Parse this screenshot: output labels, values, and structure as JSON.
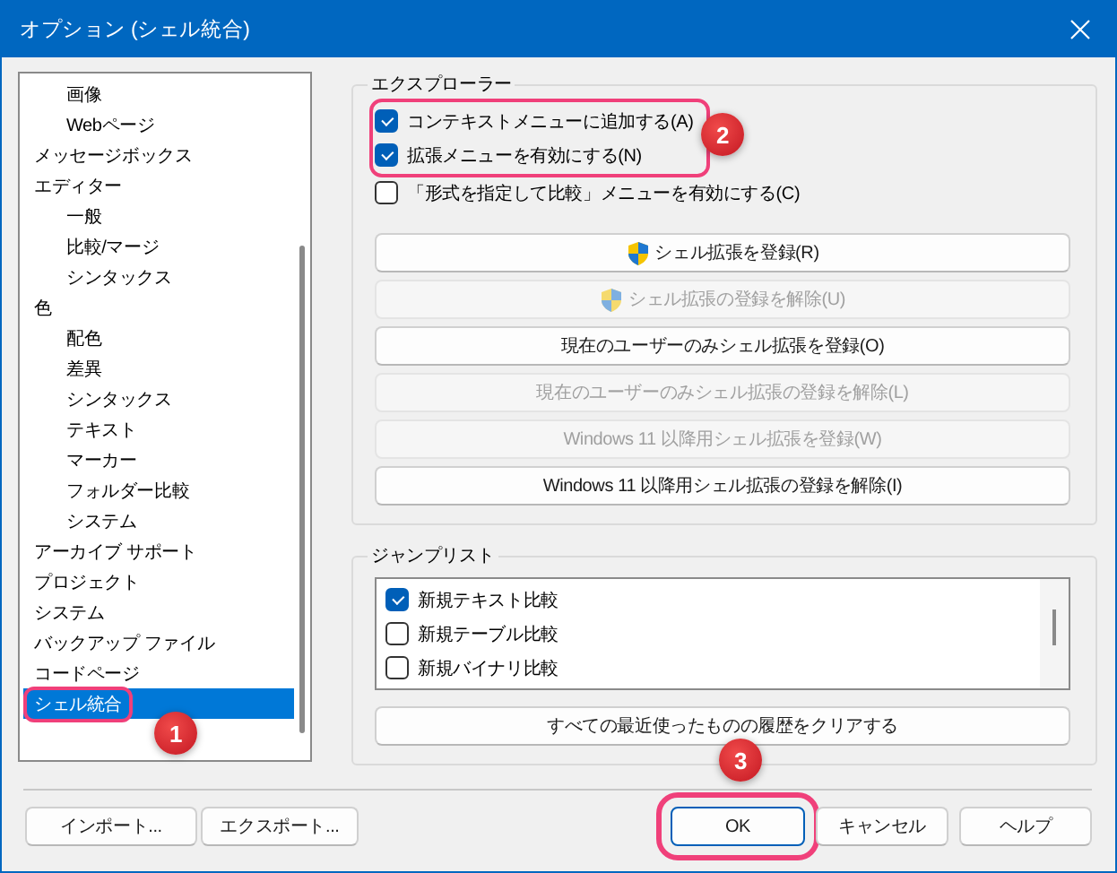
{
  "window": {
    "title": "オプション (シェル統合)"
  },
  "tree": {
    "items": [
      {
        "children": [
          {
            "label": "画像",
            "selected": false,
            "highlighted": false
          },
          {
            "label": "Webページ",
            "selected": false,
            "highlighted": false
          }
        ]
      },
      {
        "label": "メッセージボックス",
        "selected": false,
        "highlighted": false
      },
      {
        "label": "エディター",
        "selected": false,
        "highlighted": false,
        "children": [
          {
            "label": "一般",
            "selected": false,
            "highlighted": false
          },
          {
            "label": "比較/マージ",
            "selected": false,
            "highlighted": false
          },
          {
            "label": "シンタックス",
            "selected": false,
            "highlighted": false
          }
        ]
      },
      {
        "label": "色",
        "selected": false,
        "highlighted": false,
        "children": [
          {
            "label": "配色",
            "selected": false,
            "highlighted": false
          },
          {
            "label": "差異",
            "selected": false,
            "highlighted": false
          },
          {
            "label": "シンタックス",
            "selected": false,
            "highlighted": false
          },
          {
            "label": "テキスト",
            "selected": false,
            "highlighted": false
          },
          {
            "label": "マーカー",
            "selected": false,
            "highlighted": false
          },
          {
            "label": "フォルダー比較",
            "selected": false,
            "highlighted": false
          },
          {
            "label": "システム",
            "selected": false,
            "highlighted": false
          }
        ]
      },
      {
        "label": "アーカイブ サポート",
        "selected": false,
        "highlighted": false
      },
      {
        "label": "プロジェクト",
        "selected": false,
        "highlighted": false
      },
      {
        "label": "システム",
        "selected": false,
        "highlighted": false
      },
      {
        "label": "バックアップ ファイル",
        "selected": false,
        "highlighted": false
      },
      {
        "label": "コードページ",
        "selected": false,
        "highlighted": false
      },
      {
        "label": "シェル統合",
        "selected": true,
        "highlighted": true
      }
    ]
  },
  "explorer": {
    "title": "エクスプローラー",
    "options": [
      {
        "label": "コンテキストメニューに追加する(A)",
        "checked": true,
        "highlighted": true
      },
      {
        "label": "拡張メニューを有効にする(N)",
        "checked": true,
        "highlighted": true
      },
      {
        "label": "「形式を指定して比較」メニューを有効にする(C)",
        "checked": false,
        "highlighted": false
      }
    ],
    "buttons": [
      {
        "label": "シェル拡張を登録(R)",
        "shield": true,
        "disabled": false
      },
      {
        "label": "シェル拡張の登録を解除(U)",
        "shield": true,
        "disabled": true
      },
      {
        "label": "現在のユーザーのみシェル拡張を登録(O)",
        "shield": false,
        "disabled": false
      },
      {
        "label": "現在のユーザーのみシェル拡張の登録を解除(L)",
        "shield": false,
        "disabled": true
      },
      {
        "label": "Windows 11 以降用シェル拡張を登録(W)",
        "shield": false,
        "disabled": true
      },
      {
        "label": "Windows 11 以降用シェル拡張の登録を解除(I)",
        "shield": false,
        "disabled": false
      }
    ]
  },
  "jump_list": {
    "title": "ジャンプリスト",
    "items": [
      {
        "label": "新規テキスト比較",
        "checked": true
      },
      {
        "label": "新規テーブル比較",
        "checked": false
      },
      {
        "label": "新規バイナリ比較",
        "checked": false
      }
    ],
    "clear_button": "すべての最近使ったものの履歴をクリアする"
  },
  "footer": {
    "left_buttons": [
      {
        "label": "インポート...",
        "default": false,
        "highlighted": false
      },
      {
        "label": "エクスポート...",
        "default": false,
        "highlighted": false
      }
    ],
    "right_buttons": [
      {
        "label": "OK",
        "default": true,
        "highlighted": true
      },
      {
        "label": "キャンセル",
        "default": false,
        "highlighted": false
      },
      {
        "label": "ヘルプ",
        "default": false,
        "highlighted": false
      }
    ]
  },
  "callouts": [
    {
      "number": "1"
    },
    {
      "number": "2"
    },
    {
      "number": "3"
    }
  ]
}
